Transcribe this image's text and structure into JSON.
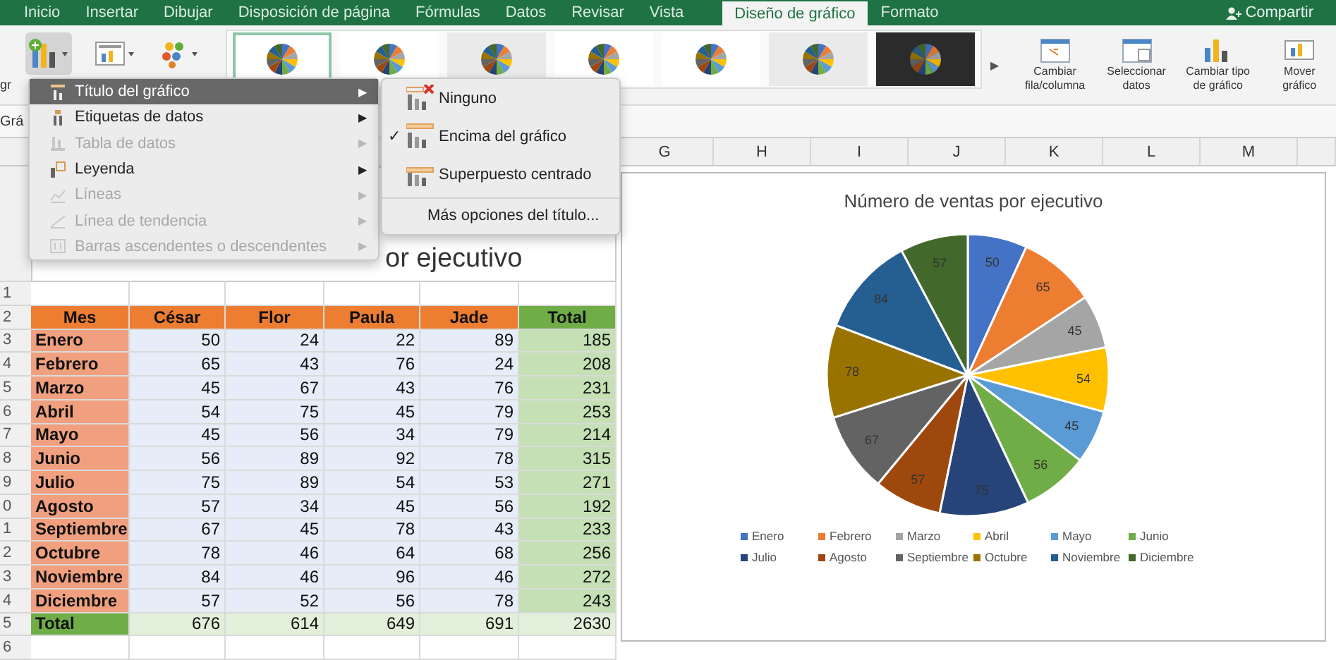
{
  "tabs": [
    {
      "label": "Inicio",
      "selected": false
    },
    {
      "label": "Insertar",
      "selected": false
    },
    {
      "label": "Dibujar",
      "selected": false
    },
    {
      "label": "Disposición de página",
      "selected": false
    },
    {
      "label": "Fórmulas",
      "selected": false
    },
    {
      "label": "Datos",
      "selected": false
    },
    {
      "label": "Revisar",
      "selected": false
    },
    {
      "label": "Vista",
      "selected": false
    },
    {
      "label": "Diseño de gráfico",
      "selected": true
    },
    {
      "label": "Formato",
      "selected": false
    }
  ],
  "share": "Compartir",
  "ribbon": {
    "cut_label": "gr",
    "styles": [
      {
        "kind": "light",
        "selected": true
      },
      {
        "kind": "light",
        "selected": false
      },
      {
        "kind": "gray",
        "selected": false
      },
      {
        "kind": "light",
        "selected": false
      },
      {
        "kind": "light",
        "selected": false
      },
      {
        "kind": "gray",
        "selected": false
      },
      {
        "kind": "dark",
        "selected": false
      }
    ],
    "more": "▶",
    "buttons": [
      {
        "kind": "switch",
        "lines": [
          "Cambiar",
          "fila/columna"
        ]
      },
      {
        "kind": "select",
        "lines": [
          "Seleccionar",
          "datos"
        ]
      },
      {
        "kind": "type",
        "lines": [
          "Cambiar tipo",
          "de gráfico"
        ]
      },
      {
        "kind": "move",
        "lines": [
          "Mover",
          "gráfico"
        ]
      }
    ]
  },
  "name_box": "Grá",
  "columns": [
    "G",
    "H",
    "I",
    "J",
    "K",
    "L",
    "M"
  ],
  "behind_title": "or ejecutivo",
  "row_numbers": [
    "1",
    "2",
    "3",
    "4",
    "5",
    "6",
    "7",
    "8",
    "9",
    "0",
    "1",
    "2",
    "3",
    "4",
    "5",
    "6"
  ],
  "table": {
    "header": [
      "Mes",
      "César",
      "Flor",
      "Paula",
      "Jade",
      "Total"
    ],
    "rows": [
      [
        "Enero",
        "50",
        "24",
        "22",
        "89",
        "185"
      ],
      [
        "Febrero",
        "65",
        "43",
        "76",
        "24",
        "208"
      ],
      [
        "Marzo",
        "45",
        "67",
        "43",
        "76",
        "231"
      ],
      [
        "Abril",
        "54",
        "75",
        "45",
        "79",
        "253"
      ],
      [
        "Mayo",
        "45",
        "56",
        "34",
        "79",
        "214"
      ],
      [
        "Junio",
        "56",
        "89",
        "92",
        "78",
        "315"
      ],
      [
        "Julio",
        "75",
        "89",
        "54",
        "53",
        "271"
      ],
      [
        "Agosto",
        "57",
        "34",
        "45",
        "56",
        "192"
      ],
      [
        "Septiembre",
        "67",
        "45",
        "78",
        "43",
        "233"
      ],
      [
        "Octubre",
        "78",
        "46",
        "64",
        "68",
        "256"
      ],
      [
        "Noviembre",
        "84",
        "46",
        "96",
        "46",
        "272"
      ],
      [
        "Diciembre",
        "57",
        "52",
        "56",
        "78",
        "243"
      ]
    ],
    "totals": [
      "Total",
      "676",
      "614",
      "649",
      "691",
      "2630"
    ]
  },
  "chart": {
    "legend": [
      {
        "color": "#4472c4"
      },
      {
        "color": "#ed7d31"
      },
      {
        "color": "#a5a5a5"
      },
      {
        "color": "#ffc000"
      },
      {
        "color": "#5b9bd5"
      },
      {
        "color": "#70ad47"
      },
      {
        "color": "#264478"
      },
      {
        "color": "#9e480e"
      },
      {
        "color": "#636363"
      },
      {
        "color": "#997300"
      },
      {
        "color": "#255e91"
      },
      {
        "color": "#43682b"
      }
    ],
    "chart_data": {
      "type": "pie",
      "title": "Número de ventas por ejecutivo",
      "categories": [
        "Enero",
        "Febrero",
        "Marzo",
        "Abril",
        "Mayo",
        "Junio",
        "Julio",
        "Agosto",
        "Septiembre",
        "Octubre",
        "Noviembre",
        "Diciembre"
      ],
      "series": [
        {
          "values": [
            50,
            65,
            45,
            54,
            45,
            56,
            75,
            57,
            67,
            78,
            84,
            57
          ]
        }
      ],
      "data_labels": true
    }
  },
  "menu": {
    "items": [
      {
        "kind": "title",
        "label": "Título del gráfico",
        "selected": true,
        "disabled": false
      },
      {
        "kind": "labels",
        "label": "Etiquetas de datos",
        "selected": false,
        "disabled": false
      },
      {
        "kind": "table",
        "label": "Tabla de datos",
        "selected": false,
        "disabled": true
      },
      {
        "kind": "legend",
        "label": "Leyenda",
        "selected": false,
        "disabled": false
      },
      {
        "kind": "lines",
        "label": "Líneas",
        "selected": false,
        "disabled": true
      },
      {
        "kind": "trend",
        "label": "Línea de tendencia",
        "selected": false,
        "disabled": true
      },
      {
        "kind": "bars",
        "label": "Barras ascendentes o descendentes",
        "selected": false,
        "disabled": true
      }
    ],
    "arrow": "▶"
  },
  "submenu": {
    "items": [
      {
        "kind": "none",
        "label": "Ninguno",
        "checked": false
      },
      {
        "kind": "above",
        "label": "Encima del gráfico",
        "checked": true
      },
      {
        "kind": "overlay",
        "label": "Superpuesto centrado",
        "checked": false
      }
    ],
    "check": "✓",
    "more": "Más opciones del título..."
  }
}
